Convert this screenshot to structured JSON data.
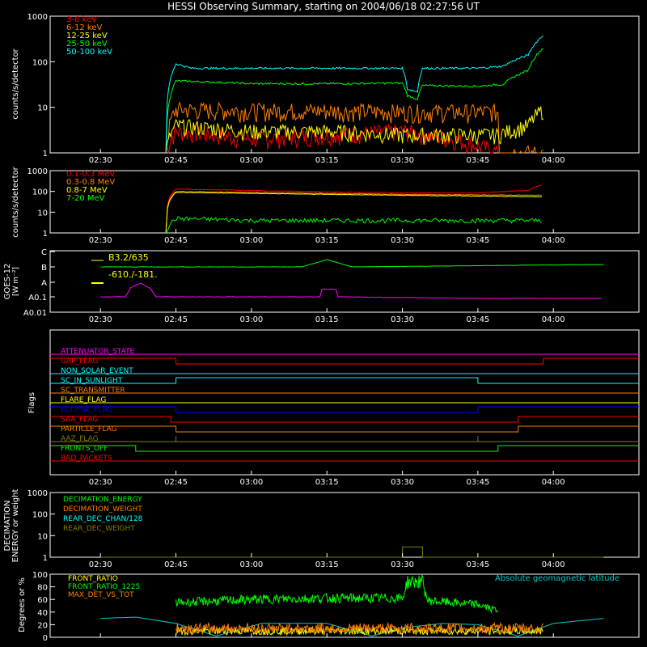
{
  "title": "HESSI Observing Summary, starting on 2004/06/18 02:27:56 UT",
  "time_ticks": [
    "02:30",
    "02:45",
    "03:00",
    "03:15",
    "03:30",
    "03:45",
    "04:00"
  ],
  "chart_data": [
    {
      "type": "line",
      "panel": "lo_energy",
      "ylabel": "counts/s/detector",
      "yscale": "log",
      "ylim": [
        1,
        1000
      ],
      "y_ticks": [
        "1",
        "10",
        "100",
        "1000"
      ],
      "legend_placement": "top-left",
      "series": [
        {
          "name": "3-6 keV",
          "color": "#ff0000",
          "points": [
            [
              "02:43",
              1
            ],
            [
              "02:45",
              3
            ],
            [
              "03:00",
              2
            ],
            [
              "03:15",
              2.5
            ],
            [
              "03:30",
              3
            ],
            [
              "03:40",
              2
            ],
            [
              "03:49",
              1
            ]
          ]
        },
        {
          "name": "6-12 keV",
          "color": "#ff8000",
          "points": [
            [
              "02:43",
              1
            ],
            [
              "02:45",
              9
            ],
            [
              "03:00",
              8.5
            ],
            [
              "03:15",
              8.5
            ],
            [
              "03:30",
              8
            ],
            [
              "03:49",
              8
            ],
            [
              "03:49",
              1
            ],
            [
              "03:58",
              1
            ]
          ]
        },
        {
          "name": "12-25 keV",
          "color": "#ffff00",
          "points": [
            [
              "02:43",
              1
            ],
            [
              "02:45",
              4
            ],
            [
              "03:00",
              3
            ],
            [
              "03:15",
              3
            ],
            [
              "03:30",
              2.5
            ],
            [
              "03:49",
              2.5
            ],
            [
              "03:55",
              4
            ],
            [
              "03:58",
              9
            ],
            [
              "03:58",
              1
            ]
          ]
        },
        {
          "name": "25-50 keV",
          "color": "#00ff00",
          "points": [
            [
              "02:43",
              1
            ],
            [
              "02:45",
              38
            ],
            [
              "03:00",
              33
            ],
            [
              "03:15",
              33
            ],
            [
              "03:30",
              34
            ],
            [
              "03:31",
              18
            ],
            [
              "03:33",
              15
            ],
            [
              "03:34",
              30
            ],
            [
              "03:45",
              29
            ],
            [
              "03:50",
              32
            ],
            [
              "03:55",
              65
            ],
            [
              "03:58",
              200
            ],
            [
              "03:58",
              1
            ]
          ]
        },
        {
          "name": "50-100 keV",
          "color": "#00ffff",
          "points": [
            [
              "02:43",
              1
            ],
            [
              "02:45",
              90
            ],
            [
              "02:48",
              72
            ],
            [
              "03:00",
              72
            ],
            [
              "03:15",
              72
            ],
            [
              "03:30",
              72
            ],
            [
              "03:31",
              25
            ],
            [
              "03:33",
              22
            ],
            [
              "03:34",
              72
            ],
            [
              "03:45",
              72
            ],
            [
              "03:50",
              80
            ],
            [
              "03:55",
              140
            ],
            [
              "03:58",
              380
            ],
            [
              "03:58",
              1
            ]
          ]
        }
      ]
    },
    {
      "type": "line",
      "panel": "hi_energy",
      "ylabel": "counts/s/detector",
      "yscale": "log",
      "ylim": [
        1,
        1000
      ],
      "y_ticks": [
        "1",
        "10",
        "100",
        "1000"
      ],
      "legend_placement": "top-left",
      "series": [
        {
          "name": "0.1-0.3 MeV",
          "color": "#ff0000",
          "points": [
            [
              "02:43",
              1
            ],
            [
              "02:45",
              130
            ],
            [
              "03:00",
              110
            ],
            [
              "03:15",
              95
            ],
            [
              "03:30",
              85
            ],
            [
              "03:45",
              85
            ],
            [
              "03:55",
              110
            ],
            [
              "03:58",
              220
            ],
            [
              "03:58",
              1
            ]
          ]
        },
        {
          "name": "0.3-0.8 MeV",
          "color": "#ff8000",
          "points": [
            [
              "02:43",
              1
            ],
            [
              "02:45",
              100
            ],
            [
              "03:00",
              90
            ],
            [
              "03:15",
              80
            ],
            [
              "03:30",
              72
            ],
            [
              "03:45",
              68
            ],
            [
              "03:58",
              65
            ],
            [
              "03:58",
              1
            ]
          ]
        },
        {
          "name": "0.8-7 MeV",
          "color": "#ffff00",
          "points": [
            [
              "02:43",
              1
            ],
            [
              "02:45",
              90
            ],
            [
              "03:00",
              80
            ],
            [
              "03:15",
              72
            ],
            [
              "03:30",
              65
            ],
            [
              "03:45",
              60
            ],
            [
              "03:58",
              55
            ],
            [
              "03:58",
              1
            ]
          ]
        },
        {
          "name": "7-20 MeV",
          "color": "#00ff00",
          "points": [
            [
              "02:43",
              1
            ],
            [
              "02:45",
              5
            ],
            [
              "03:00",
              4
            ],
            [
              "03:15",
              4
            ],
            [
              "03:30",
              4
            ],
            [
              "03:45",
              4
            ],
            [
              "03:58",
              4
            ],
            [
              "03:58",
              1
            ]
          ]
        }
      ]
    },
    {
      "type": "line",
      "panel": "goes",
      "ylabel": "GOES-12",
      "ylabel_unit": "[W m⁻²]",
      "y_ticks": [
        "A0.01",
        "A0.1",
        "A",
        "B",
        "C"
      ],
      "annotations": [
        "B3.2/635",
        "-610./-181."
      ],
      "series": [
        {
          "color": "#00ff00",
          "level": "B",
          "points": [
            [
              "02:30",
              3.05
            ],
            [
              "03:10",
              3.05
            ],
            [
              "03:15",
              3.2
            ],
            [
              "03:20",
              3.05
            ],
            [
              "04:10",
              3.1
            ]
          ]
        },
        {
          "color": "#ff00ff",
          "level": "A0.1",
          "points": [
            [
              "02:30",
              1
            ],
            [
              "02:35",
              1
            ],
            [
              "02:36",
              1.6
            ],
            [
              "02:38",
              1.9
            ],
            [
              "02:40",
              1.5
            ],
            [
              "02:41",
              1
            ],
            [
              "03:14",
              1
            ],
            [
              "03:14",
              1.5
            ],
            [
              "03:17",
              1.5
            ],
            [
              "03:17",
              1
            ],
            [
              "03:45",
              0.9
            ],
            [
              "04:10",
              0.9
            ]
          ]
        }
      ]
    },
    {
      "type": "line",
      "panel": "flags",
      "ylabel": "Flags",
      "series": [
        {
          "name": "ATTENUATOR_STATE",
          "color": "#ff00ff",
          "steps": [
            [
              "02:30",
              0
            ]
          ]
        },
        {
          "name": "GAP_FLAG",
          "color": "#ff0000",
          "steps": [
            [
              "02:30",
              1
            ],
            [
              "02:45",
              0
            ],
            [
              "03:58",
              1
            ]
          ]
        },
        {
          "name": "NON_SOLAR_EVENT",
          "color": "#00ffff",
          "steps": [
            [
              "02:30",
              0
            ]
          ]
        },
        {
          "name": "SC_IN_SUNLIGHT",
          "color": "#00ffff",
          "steps": [
            [
              "02:30",
              0
            ],
            [
              "02:45",
              1
            ],
            [
              "03:45",
              0
            ]
          ]
        },
        {
          "name": "SC_TRANSMITTER",
          "color": "#ff8000",
          "steps": [
            [
              "02:30",
              0
            ]
          ]
        },
        {
          "name": "FLARE_FLAG",
          "color": "#ffff00",
          "steps": [
            [
              "02:30",
              0
            ]
          ]
        },
        {
          "name": "ECLIPSE_FLAG",
          "color": "#0000ff",
          "steps": [
            [
              "02:30",
              1
            ],
            [
              "02:45",
              0
            ],
            [
              "03:45",
              1
            ]
          ]
        },
        {
          "name": "SAA_FLAG",
          "color": "#ff0000",
          "steps": [
            [
              "02:30",
              1
            ],
            [
              "02:44",
              0
            ],
            [
              "03:53",
              1
            ]
          ]
        },
        {
          "name": "PARTICLE_FLAG",
          "color": "#ff8000",
          "steps": [
            [
              "02:30",
              1
            ],
            [
              "02:45",
              0
            ],
            [
              "03:53",
              1
            ]
          ]
        },
        {
          "name": "AAZ_FLAG",
          "color": "#808000",
          "steps": [
            [
              "02:30",
              0
            ],
            [
              "02:45",
              1
            ],
            [
              "02:45",
              0
            ],
            [
              "03:45",
              1
            ],
            [
              "03:45",
              0
            ]
          ]
        },
        {
          "name": "FRONTS_OFF",
          "color": "#00ff00",
          "steps": [
            [
              "02:30",
              1
            ],
            [
              "02:37",
              0
            ],
            [
              "03:49",
              1
            ]
          ]
        },
        {
          "name": "BAD_PACKETS",
          "color": "#ff0000",
          "steps": [
            [
              "02:30",
              0
            ]
          ]
        }
      ]
    },
    {
      "type": "line",
      "panel": "decimation",
      "ylabel": "DECIMATION ENERGY or weight",
      "yscale": "log",
      "ylim": [
        1,
        1000
      ],
      "y_ticks": [
        "1",
        "10",
        "100",
        "1000"
      ],
      "series": [
        {
          "name": "DECIMATION_ENERGY",
          "color": "#00ff00"
        },
        {
          "name": "DECIMATION_WEIGHT",
          "color": "#ff8000"
        },
        {
          "name": "REAR_DEC_CHAN/128",
          "color": "#00ffff"
        },
        {
          "name": "REAR_DEC_WEIGHT",
          "color": "#808000",
          "points": [
            [
              "02:30",
              1
            ],
            [
              "03:30",
              1
            ],
            [
              "03:30",
              3
            ],
            [
              "03:34",
              3
            ],
            [
              "03:34",
              1
            ],
            [
              "04:10",
              1
            ]
          ]
        }
      ]
    },
    {
      "type": "line",
      "panel": "ratios",
      "ylabel": "Degrees or %",
      "ylim": [
        0,
        100
      ],
      "y_ticks": [
        "0",
        "20",
        "40",
        "60",
        "80",
        "100"
      ],
      "series": [
        {
          "name": "FRONT_RATIO",
          "color": "#ffff00",
          "mean": 10
        },
        {
          "name": "FRONT_RATIO_1225",
          "color": "#00ff00",
          "points": [
            [
              "02:45",
              55
            ],
            [
              "03:00",
              60
            ],
            [
              "03:15",
              62
            ],
            [
              "03:30",
              62
            ],
            [
              "03:31",
              88
            ],
            [
              "03:34",
              88
            ],
            [
              "03:35",
              58
            ],
            [
              "03:45",
              52
            ],
            [
              "03:49",
              42
            ]
          ]
        },
        {
          "name": "MAX_DET_VS_TOT",
          "color": "#ff8000",
          "mean": 14
        },
        {
          "name": "Absolute geomagnetic latitude",
          "color": "#00cccc",
          "points": [
            [
              "02:30",
              30
            ],
            [
              "02:37",
              32
            ],
            [
              "02:45",
              22
            ],
            [
              "02:53",
              2
            ],
            [
              "03:02",
              22
            ],
            [
              "03:15",
              22
            ],
            [
              "03:24",
              2
            ],
            [
              "03:30",
              15
            ],
            [
              "03:38",
              22
            ],
            [
              "03:45",
              20
            ],
            [
              "03:53",
              2
            ],
            [
              "04:00",
              22
            ],
            [
              "04:10",
              30
            ]
          ]
        }
      ]
    }
  ]
}
